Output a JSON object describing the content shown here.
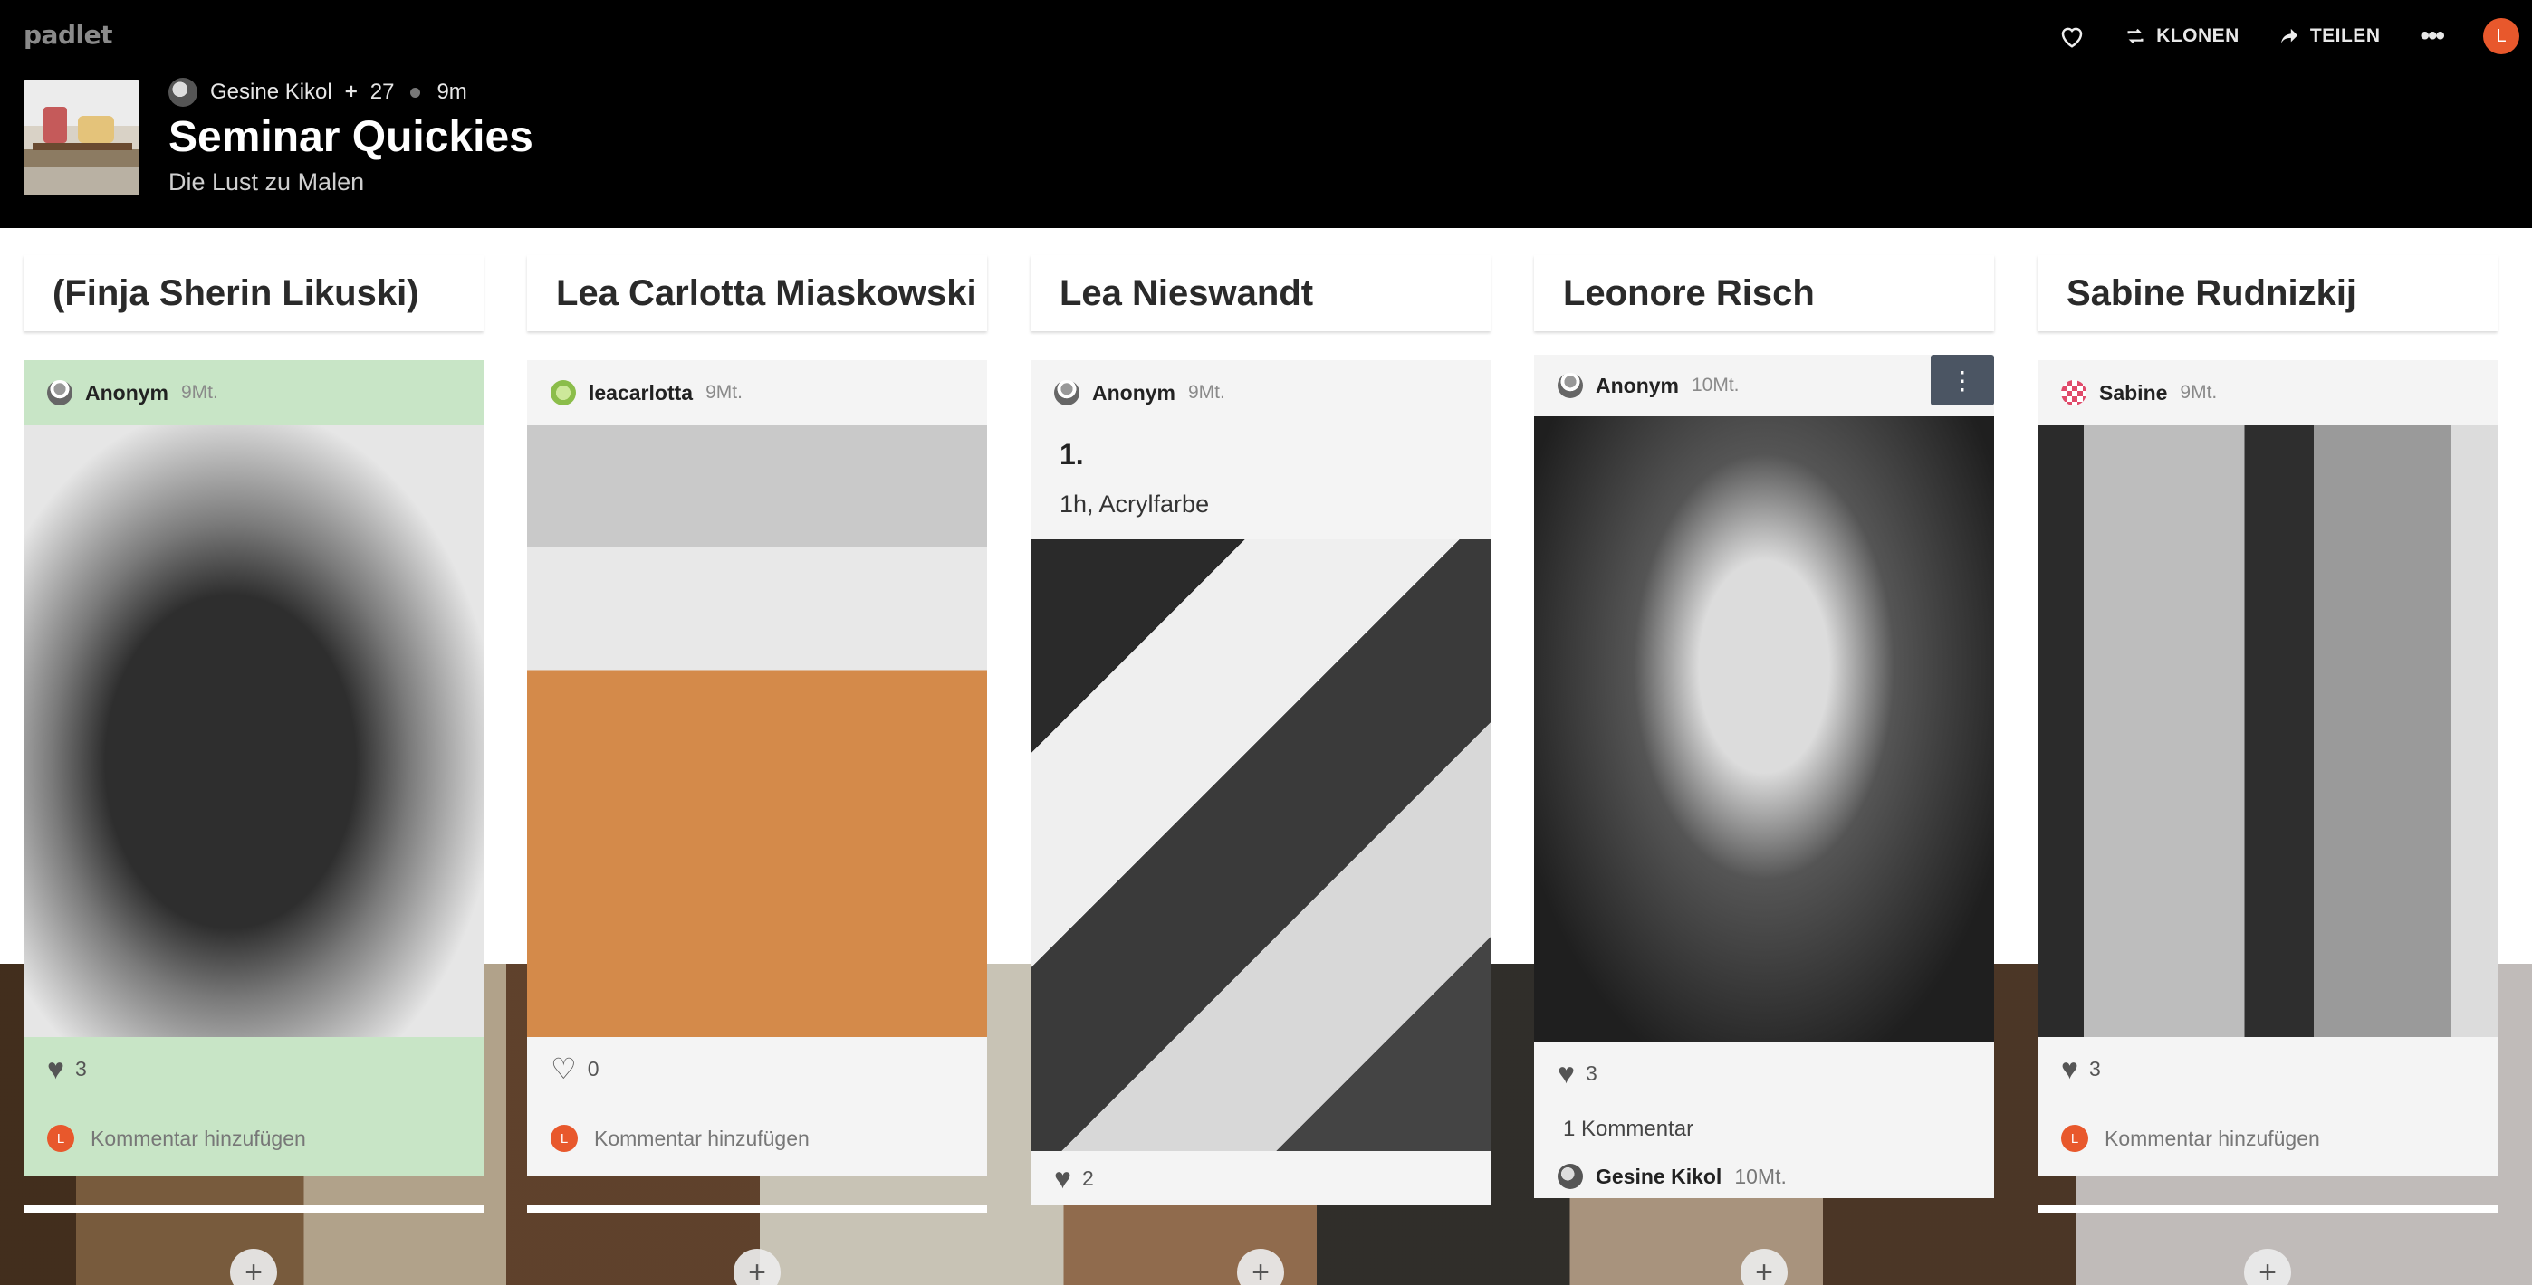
{
  "app": {
    "logo": "padlet"
  },
  "toolbar": {
    "like_icon": "heart-outline-icon",
    "clone_label": "KLONEN",
    "share_label": "TEILEN",
    "more_icon": "more-horizontal-icon",
    "user_initial": "L",
    "accent": "#e8582c"
  },
  "board": {
    "author": "Gesine Kikol",
    "contributors": "27",
    "age": "9m",
    "title": "Seminar Quickies",
    "subtitle": "Die Lust zu Malen"
  },
  "columns": [
    {
      "title": "(Finja Sherin Likuski)",
      "post": {
        "author": "Anonym",
        "time": "9Mt.",
        "likes": "3",
        "comment_placeholder": "Kommentar hinzufügen",
        "comment_avatar": "L",
        "background": "#c8e5c6"
      }
    },
    {
      "title": "Lea Carlotta Miaskowski",
      "post": {
        "author": "leacarlotta",
        "time": "9Mt.",
        "likes": "0",
        "comment_placeholder": "Kommentar hinzufügen",
        "comment_avatar": "L"
      }
    },
    {
      "title": "Lea Nieswandt",
      "post": {
        "author": "Anonym",
        "time": "9Mt.",
        "text_title": "1.",
        "text_body": "1h, Acrylfarbe",
        "likes": "2"
      }
    },
    {
      "title": "Leonore Risch",
      "post": {
        "author": "Anonym",
        "time": "10Mt.",
        "likes": "3",
        "comment_count": "1 Kommentar",
        "commenter": "Gesine Kikol",
        "commenter_time": "10Mt."
      }
    },
    {
      "title": "Sabine Rudnizkij",
      "post": {
        "author": "Sabine",
        "time": "9Mt.",
        "likes": "3",
        "comment_placeholder": "Kommentar hinzufügen",
        "comment_avatar": "L"
      }
    }
  ],
  "add_post_symbol": "+"
}
